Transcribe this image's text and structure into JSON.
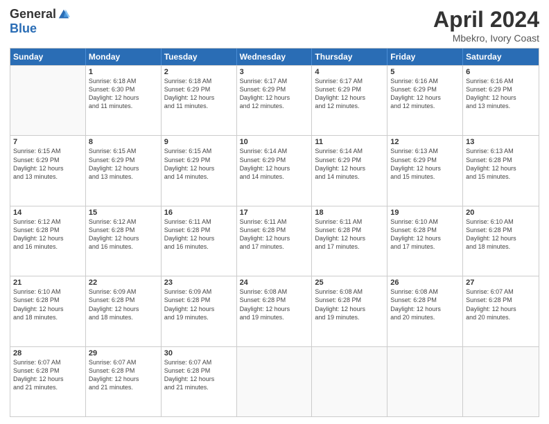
{
  "logo": {
    "general": "General",
    "blue": "Blue"
  },
  "title": {
    "month": "April 2024",
    "location": "Mbekro, Ivory Coast"
  },
  "header": {
    "days": [
      "Sunday",
      "Monday",
      "Tuesday",
      "Wednesday",
      "Thursday",
      "Friday",
      "Saturday"
    ]
  },
  "weeks": [
    [
      {
        "day": "",
        "empty": true
      },
      {
        "day": "1",
        "sunrise": "6:18 AM",
        "sunset": "6:30 PM",
        "daylight": "12 hours and 11 minutes."
      },
      {
        "day": "2",
        "sunrise": "6:18 AM",
        "sunset": "6:29 PM",
        "daylight": "12 hours and 11 minutes."
      },
      {
        "day": "3",
        "sunrise": "6:17 AM",
        "sunset": "6:29 PM",
        "daylight": "12 hours and 12 minutes."
      },
      {
        "day": "4",
        "sunrise": "6:17 AM",
        "sunset": "6:29 PM",
        "daylight": "12 hours and 12 minutes."
      },
      {
        "day": "5",
        "sunrise": "6:16 AM",
        "sunset": "6:29 PM",
        "daylight": "12 hours and 12 minutes."
      },
      {
        "day": "6",
        "sunrise": "6:16 AM",
        "sunset": "6:29 PM",
        "daylight": "12 hours and 13 minutes."
      }
    ],
    [
      {
        "day": "7",
        "sunrise": "6:15 AM",
        "sunset": "6:29 PM",
        "daylight": "12 hours and 13 minutes."
      },
      {
        "day": "8",
        "sunrise": "6:15 AM",
        "sunset": "6:29 PM",
        "daylight": "12 hours and 13 minutes."
      },
      {
        "day": "9",
        "sunrise": "6:15 AM",
        "sunset": "6:29 PM",
        "daylight": "12 hours and 14 minutes."
      },
      {
        "day": "10",
        "sunrise": "6:14 AM",
        "sunset": "6:29 PM",
        "daylight": "12 hours and 14 minutes."
      },
      {
        "day": "11",
        "sunrise": "6:14 AM",
        "sunset": "6:29 PM",
        "daylight": "12 hours and 14 minutes."
      },
      {
        "day": "12",
        "sunrise": "6:13 AM",
        "sunset": "6:29 PM",
        "daylight": "12 hours and 15 minutes."
      },
      {
        "day": "13",
        "sunrise": "6:13 AM",
        "sunset": "6:28 PM",
        "daylight": "12 hours and 15 minutes."
      }
    ],
    [
      {
        "day": "14",
        "sunrise": "6:12 AM",
        "sunset": "6:28 PM",
        "daylight": "12 hours and 16 minutes."
      },
      {
        "day": "15",
        "sunrise": "6:12 AM",
        "sunset": "6:28 PM",
        "daylight": "12 hours and 16 minutes."
      },
      {
        "day": "16",
        "sunrise": "6:11 AM",
        "sunset": "6:28 PM",
        "daylight": "12 hours and 16 minutes."
      },
      {
        "day": "17",
        "sunrise": "6:11 AM",
        "sunset": "6:28 PM",
        "daylight": "12 hours and 17 minutes."
      },
      {
        "day": "18",
        "sunrise": "6:11 AM",
        "sunset": "6:28 PM",
        "daylight": "12 hours and 17 minutes."
      },
      {
        "day": "19",
        "sunrise": "6:10 AM",
        "sunset": "6:28 PM",
        "daylight": "12 hours and 17 minutes."
      },
      {
        "day": "20",
        "sunrise": "6:10 AM",
        "sunset": "6:28 PM",
        "daylight": "12 hours and 18 minutes."
      }
    ],
    [
      {
        "day": "21",
        "sunrise": "6:10 AM",
        "sunset": "6:28 PM",
        "daylight": "12 hours and 18 minutes."
      },
      {
        "day": "22",
        "sunrise": "6:09 AM",
        "sunset": "6:28 PM",
        "daylight": "12 hours and 18 minutes."
      },
      {
        "day": "23",
        "sunrise": "6:09 AM",
        "sunset": "6:28 PM",
        "daylight": "12 hours and 19 minutes."
      },
      {
        "day": "24",
        "sunrise": "6:08 AM",
        "sunset": "6:28 PM",
        "daylight": "12 hours and 19 minutes."
      },
      {
        "day": "25",
        "sunrise": "6:08 AM",
        "sunset": "6:28 PM",
        "daylight": "12 hours and 19 minutes."
      },
      {
        "day": "26",
        "sunrise": "6:08 AM",
        "sunset": "6:28 PM",
        "daylight": "12 hours and 20 minutes."
      },
      {
        "day": "27",
        "sunrise": "6:07 AM",
        "sunset": "6:28 PM",
        "daylight": "12 hours and 20 minutes."
      }
    ],
    [
      {
        "day": "28",
        "sunrise": "6:07 AM",
        "sunset": "6:28 PM",
        "daylight": "12 hours and 21 minutes."
      },
      {
        "day": "29",
        "sunrise": "6:07 AM",
        "sunset": "6:28 PM",
        "daylight": "12 hours and 21 minutes."
      },
      {
        "day": "30",
        "sunrise": "6:07 AM",
        "sunset": "6:28 PM",
        "daylight": "12 hours and 21 minutes."
      },
      {
        "day": "",
        "empty": true
      },
      {
        "day": "",
        "empty": true
      },
      {
        "day": "",
        "empty": true
      },
      {
        "day": "",
        "empty": true
      }
    ]
  ],
  "labels": {
    "sunrise": "Sunrise:",
    "sunset": "Sunset:",
    "daylight": "Daylight:"
  }
}
